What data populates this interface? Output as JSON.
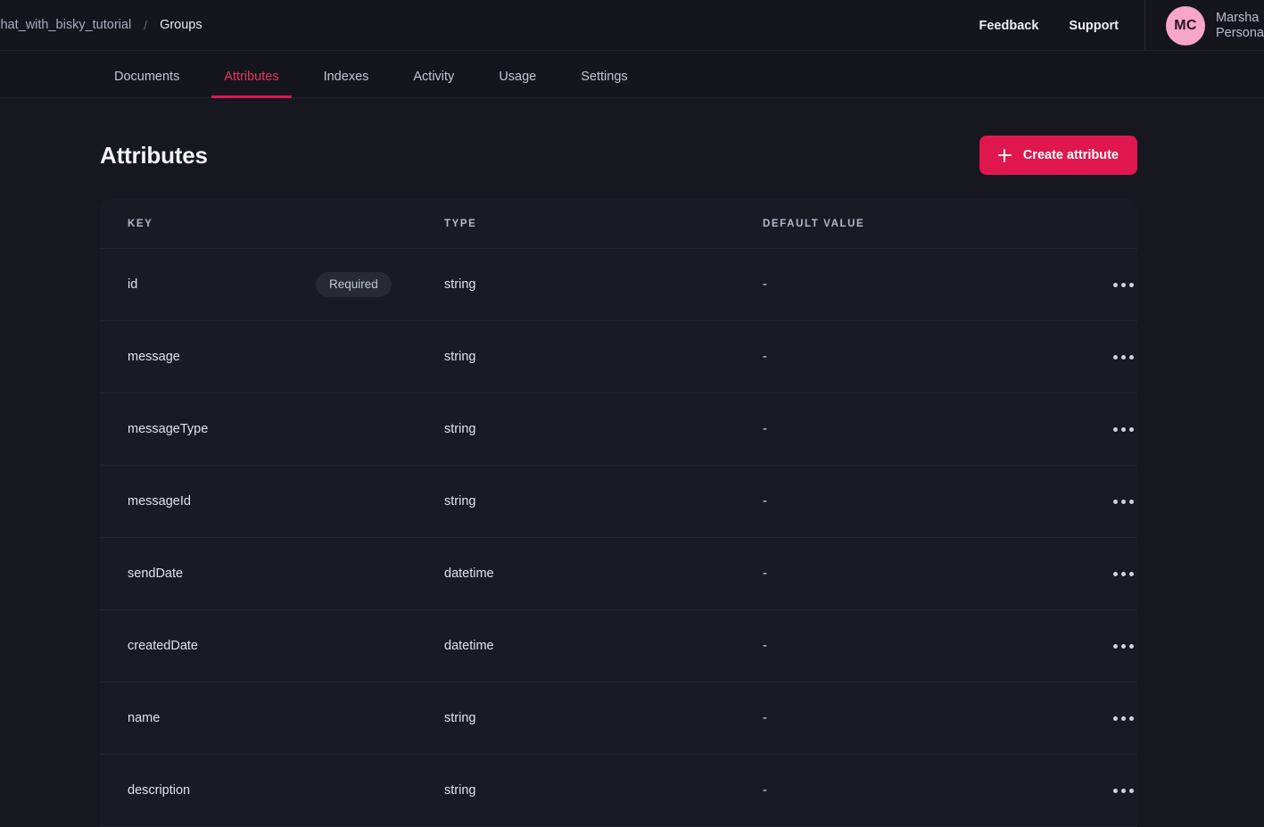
{
  "header": {
    "breadcrumb": {
      "project": "Chat_with_bisky_tutorial",
      "separator": "/",
      "current": "Groups"
    },
    "links": [
      {
        "label": "Feedback",
        "name": "feedback-link"
      },
      {
        "label": "Support",
        "name": "support-link"
      }
    ],
    "user": {
      "avatar_initials": "MC",
      "avatar_color": "#f7a6c8",
      "name": "Marsha",
      "org": "Persona"
    }
  },
  "tabs": [
    {
      "label": "Documents",
      "active": false
    },
    {
      "label": "Attributes",
      "active": true
    },
    {
      "label": "Indexes",
      "active": false
    },
    {
      "label": "Activity",
      "active": false
    },
    {
      "label": "Usage",
      "active": false
    },
    {
      "label": "Settings",
      "active": false
    }
  ],
  "main": {
    "title": "Attributes",
    "create_button": "Create attribute",
    "table": {
      "columns": [
        "KEY",
        "TYPE",
        "DEFAULT VALUE"
      ],
      "rows": [
        {
          "key": "id",
          "badge": "Required",
          "type": "string",
          "default": "-",
          "menu": "row-menu"
        },
        {
          "key": "message",
          "badge": "",
          "type": "string",
          "default": "-",
          "menu": "row-menu"
        },
        {
          "key": "messageType",
          "badge": "",
          "type": "string",
          "default": "-",
          "menu": "row-menu"
        },
        {
          "key": "messageId",
          "badge": "",
          "type": "string",
          "default": "-",
          "menu": "row-menu"
        },
        {
          "key": "sendDate",
          "badge": "",
          "type": "datetime",
          "default": "-",
          "menu": "row-menu"
        },
        {
          "key": "createdDate",
          "badge": "",
          "type": "datetime",
          "default": "-",
          "menu": "row-menu"
        },
        {
          "key": "name",
          "badge": "",
          "type": "string",
          "default": "-",
          "menu": "row-menu"
        },
        {
          "key": "description",
          "badge": "",
          "type": "string",
          "default": "-",
          "menu": "row-menu"
        }
      ]
    }
  },
  "colors": {
    "accent": "#e0174e",
    "accent_text": "#e8365f",
    "page_bg": "#17171f",
    "card_bg": "#1a1a24",
    "header_bg": "#15151d",
    "border": "#24242f",
    "badge_bg": "#282935"
  }
}
